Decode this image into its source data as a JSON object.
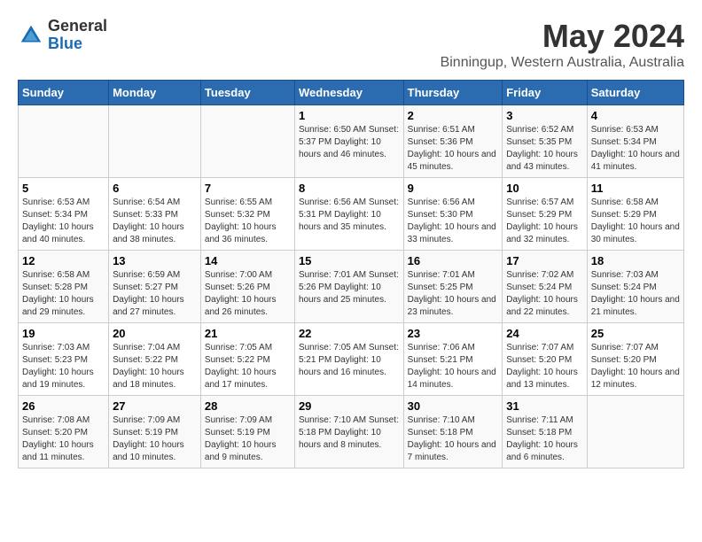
{
  "header": {
    "logo_general": "General",
    "logo_blue": "Blue",
    "title": "May 2024",
    "subtitle": "Binningup, Western Australia, Australia"
  },
  "days_of_week": [
    "Sunday",
    "Monday",
    "Tuesday",
    "Wednesday",
    "Thursday",
    "Friday",
    "Saturday"
  ],
  "weeks": [
    [
      {
        "num": "",
        "info": ""
      },
      {
        "num": "",
        "info": ""
      },
      {
        "num": "",
        "info": ""
      },
      {
        "num": "1",
        "info": "Sunrise: 6:50 AM\nSunset: 5:37 PM\nDaylight: 10 hours\nand 46 minutes."
      },
      {
        "num": "2",
        "info": "Sunrise: 6:51 AM\nSunset: 5:36 PM\nDaylight: 10 hours\nand 45 minutes."
      },
      {
        "num": "3",
        "info": "Sunrise: 6:52 AM\nSunset: 5:35 PM\nDaylight: 10 hours\nand 43 minutes."
      },
      {
        "num": "4",
        "info": "Sunrise: 6:53 AM\nSunset: 5:34 PM\nDaylight: 10 hours\nand 41 minutes."
      }
    ],
    [
      {
        "num": "5",
        "info": "Sunrise: 6:53 AM\nSunset: 5:34 PM\nDaylight: 10 hours\nand 40 minutes."
      },
      {
        "num": "6",
        "info": "Sunrise: 6:54 AM\nSunset: 5:33 PM\nDaylight: 10 hours\nand 38 minutes."
      },
      {
        "num": "7",
        "info": "Sunrise: 6:55 AM\nSunset: 5:32 PM\nDaylight: 10 hours\nand 36 minutes."
      },
      {
        "num": "8",
        "info": "Sunrise: 6:56 AM\nSunset: 5:31 PM\nDaylight: 10 hours\nand 35 minutes."
      },
      {
        "num": "9",
        "info": "Sunrise: 6:56 AM\nSunset: 5:30 PM\nDaylight: 10 hours\nand 33 minutes."
      },
      {
        "num": "10",
        "info": "Sunrise: 6:57 AM\nSunset: 5:29 PM\nDaylight: 10 hours\nand 32 minutes."
      },
      {
        "num": "11",
        "info": "Sunrise: 6:58 AM\nSunset: 5:29 PM\nDaylight: 10 hours\nand 30 minutes."
      }
    ],
    [
      {
        "num": "12",
        "info": "Sunrise: 6:58 AM\nSunset: 5:28 PM\nDaylight: 10 hours\nand 29 minutes."
      },
      {
        "num": "13",
        "info": "Sunrise: 6:59 AM\nSunset: 5:27 PM\nDaylight: 10 hours\nand 27 minutes."
      },
      {
        "num": "14",
        "info": "Sunrise: 7:00 AM\nSunset: 5:26 PM\nDaylight: 10 hours\nand 26 minutes."
      },
      {
        "num": "15",
        "info": "Sunrise: 7:01 AM\nSunset: 5:26 PM\nDaylight: 10 hours\nand 25 minutes."
      },
      {
        "num": "16",
        "info": "Sunrise: 7:01 AM\nSunset: 5:25 PM\nDaylight: 10 hours\nand 23 minutes."
      },
      {
        "num": "17",
        "info": "Sunrise: 7:02 AM\nSunset: 5:24 PM\nDaylight: 10 hours\nand 22 minutes."
      },
      {
        "num": "18",
        "info": "Sunrise: 7:03 AM\nSunset: 5:24 PM\nDaylight: 10 hours\nand 21 minutes."
      }
    ],
    [
      {
        "num": "19",
        "info": "Sunrise: 7:03 AM\nSunset: 5:23 PM\nDaylight: 10 hours\nand 19 minutes."
      },
      {
        "num": "20",
        "info": "Sunrise: 7:04 AM\nSunset: 5:22 PM\nDaylight: 10 hours\nand 18 minutes."
      },
      {
        "num": "21",
        "info": "Sunrise: 7:05 AM\nSunset: 5:22 PM\nDaylight: 10 hours\nand 17 minutes."
      },
      {
        "num": "22",
        "info": "Sunrise: 7:05 AM\nSunset: 5:21 PM\nDaylight: 10 hours\nand 16 minutes."
      },
      {
        "num": "23",
        "info": "Sunrise: 7:06 AM\nSunset: 5:21 PM\nDaylight: 10 hours\nand 14 minutes."
      },
      {
        "num": "24",
        "info": "Sunrise: 7:07 AM\nSunset: 5:20 PM\nDaylight: 10 hours\nand 13 minutes."
      },
      {
        "num": "25",
        "info": "Sunrise: 7:07 AM\nSunset: 5:20 PM\nDaylight: 10 hours\nand 12 minutes."
      }
    ],
    [
      {
        "num": "26",
        "info": "Sunrise: 7:08 AM\nSunset: 5:20 PM\nDaylight: 10 hours\nand 11 minutes."
      },
      {
        "num": "27",
        "info": "Sunrise: 7:09 AM\nSunset: 5:19 PM\nDaylight: 10 hours\nand 10 minutes."
      },
      {
        "num": "28",
        "info": "Sunrise: 7:09 AM\nSunset: 5:19 PM\nDaylight: 10 hours\nand 9 minutes."
      },
      {
        "num": "29",
        "info": "Sunrise: 7:10 AM\nSunset: 5:18 PM\nDaylight: 10 hours\nand 8 minutes."
      },
      {
        "num": "30",
        "info": "Sunrise: 7:10 AM\nSunset: 5:18 PM\nDaylight: 10 hours\nand 7 minutes."
      },
      {
        "num": "31",
        "info": "Sunrise: 7:11 AM\nSunset: 5:18 PM\nDaylight: 10 hours\nand 6 minutes."
      },
      {
        "num": "",
        "info": ""
      }
    ]
  ]
}
